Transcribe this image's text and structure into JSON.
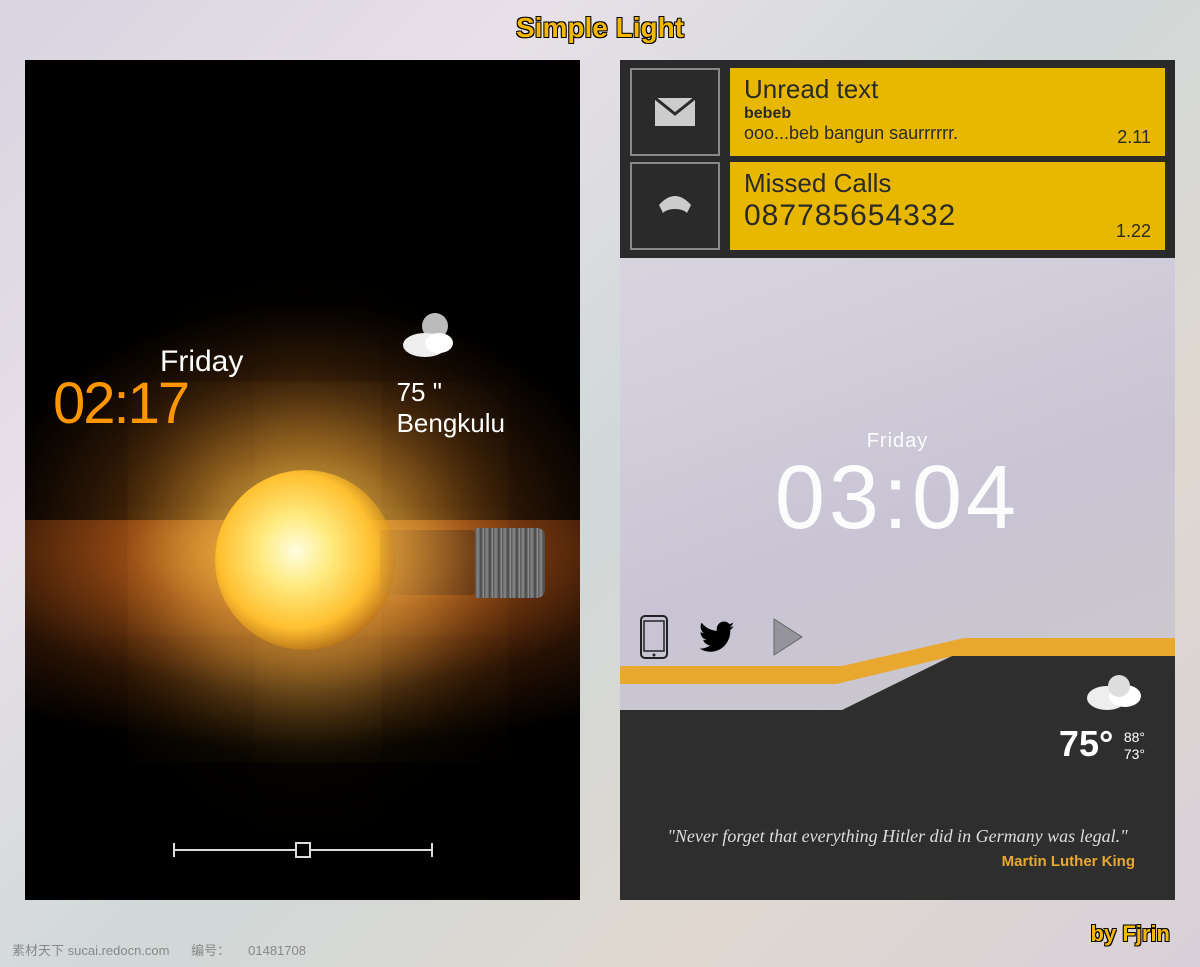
{
  "title": "Simple Light",
  "author": "by Fjrin",
  "left": {
    "time": "02:17",
    "day": "Friday",
    "temp": "75  \"",
    "location": "Bengkulu"
  },
  "right": {
    "notifications": {
      "unread": {
        "title": "Unread text",
        "sender": "bebeb",
        "preview": "ooo...beb bangun saurrrrrr.",
        "time": "2.11"
      },
      "missed": {
        "title": "Missed Calls",
        "number": "087785654332",
        "time": "1.22"
      }
    },
    "day": "Friday",
    "time": "03:04",
    "weather": {
      "temp": "75°",
      "high": "88°",
      "low": "73°"
    },
    "quote": {
      "text": "\"Never forget that everything Hitler did in Germany was legal.\"",
      "author": "Martin Luther King"
    }
  },
  "watermark": {
    "site": "素材天下 sucai.redocn.com",
    "id_label": "编号：",
    "id": "01481708"
  }
}
